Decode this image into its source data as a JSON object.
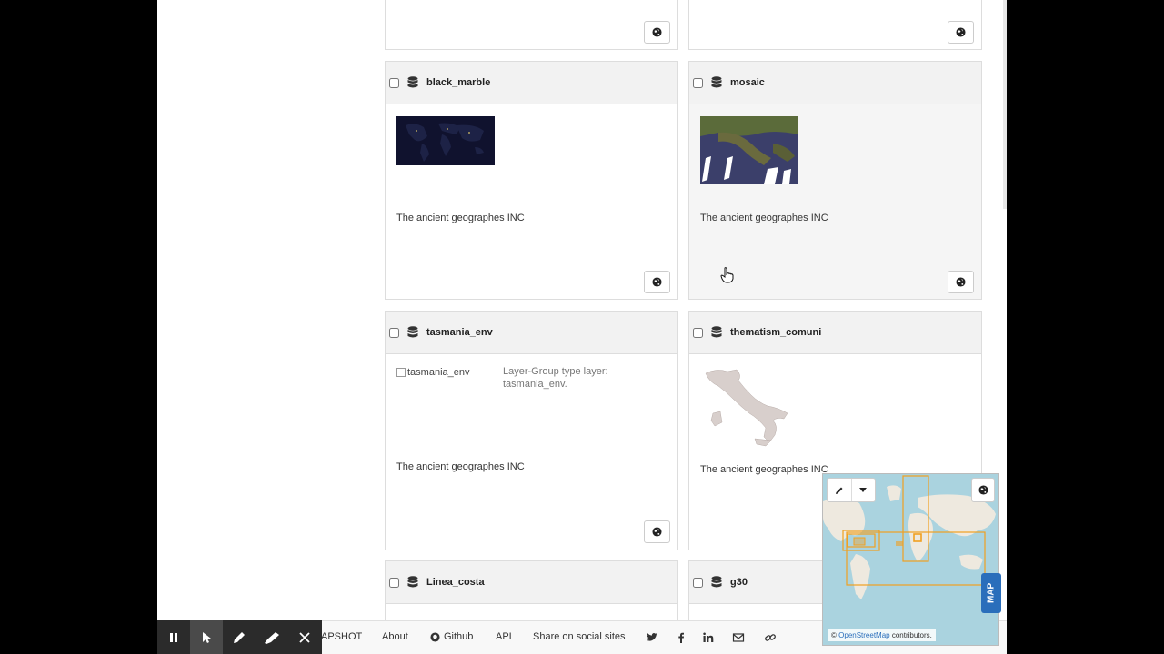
{
  "cards": [
    {
      "id": "black_marble",
      "title": "black_marble",
      "attribution": "The ancient geographes INC"
    },
    {
      "id": "mosaic",
      "title": "mosaic",
      "attribution": "The ancient geographes INC"
    },
    {
      "id": "tasmania_env",
      "title": "tasmania_env",
      "image_alt": "tasmania_env",
      "description": "Layer-Group type layer: tasmania_env.",
      "attribution": "The ancient geographes INC"
    },
    {
      "id": "thematism_comuni",
      "title": "thematism_comuni",
      "attribution": "The ancient geographes INC"
    },
    {
      "id": "linea_costa",
      "title": "Linea_costa"
    },
    {
      "id": "g30",
      "title": "g30"
    }
  ],
  "bottom_bar": {
    "snapshot": "APSHOT",
    "about": "About",
    "github": "Github",
    "api": "API",
    "share": "Share on social sites"
  },
  "minimap": {
    "attribution_prefix": "©",
    "attribution_link": "OpenStreetMap",
    "attribution_suffix": "contributors.",
    "tab_label": "MAP"
  },
  "icons": [
    "database-icon",
    "globe-icon",
    "pencil-icon",
    "caret-down-icon",
    "pause-icon",
    "cursor-icon",
    "pen-icon",
    "highlighter-icon",
    "close-icon",
    "github-icon",
    "twitter-icon",
    "facebook-icon",
    "linkedin-icon",
    "email-icon",
    "link-icon"
  ],
  "colors": {
    "map_water": "#aad3df",
    "bbox": "#f0a020",
    "map_tab": "#2a6ebb"
  }
}
